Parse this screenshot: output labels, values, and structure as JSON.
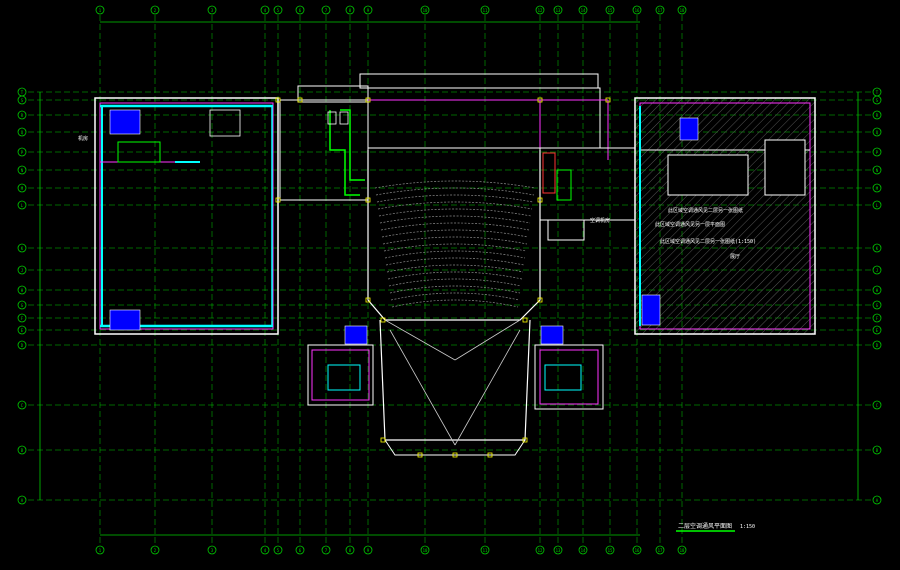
{
  "drawing": {
    "title": "二层空调通风平面图",
    "scale": "1:150",
    "notes_right": [
      "此区域空调通风见二层另一张图纸",
      "此区域空调通风见另一层平面图",
      "此区域空调通风见二层另一张图纸(1:150)"
    ],
    "room_label_right": "展厅",
    "equipment_note_left": "机房",
    "note_mid": "空调机房"
  },
  "grid": {
    "columns": [
      "1",
      "2",
      "3",
      "4",
      "5",
      "6",
      "7",
      "8",
      "9",
      "10",
      "11",
      "12",
      "13",
      "14",
      "15",
      "16",
      "17",
      "18"
    ],
    "rows": [
      "T",
      "S",
      "R",
      "Q",
      "P",
      "N",
      "M",
      "L",
      "K",
      "J",
      "H",
      "G",
      "F",
      "E",
      "D",
      "C",
      "B",
      "A"
    ]
  },
  "colors": {
    "background": "#000000",
    "wall": "#ffffff",
    "grid": "#00cc00",
    "duct": "#00ffff",
    "partition": "#ff33ff",
    "column": "#ffff00",
    "equipment": "#0000ff"
  }
}
